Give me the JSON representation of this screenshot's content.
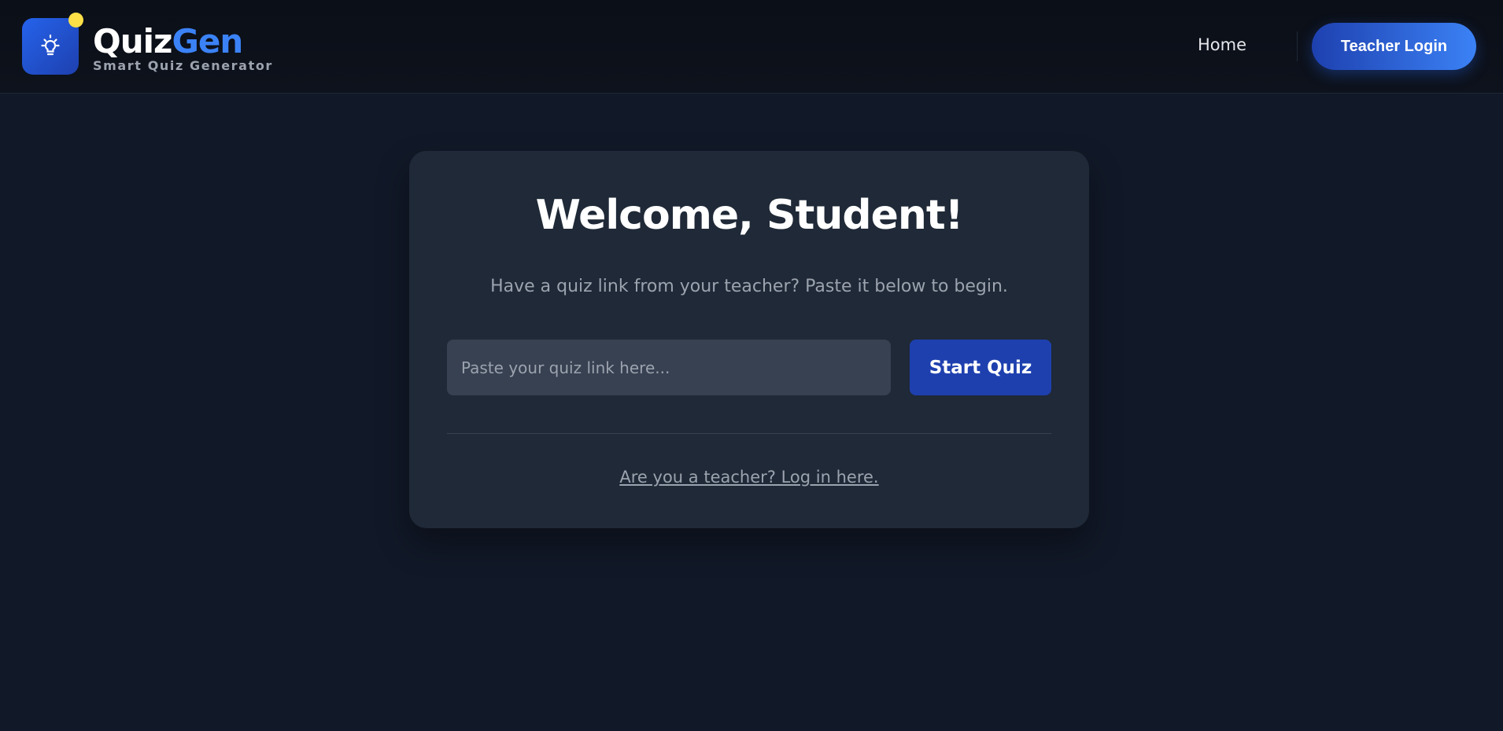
{
  "header": {
    "brand_part1": "Quiz",
    "brand_part2": "Gen",
    "tagline": "Smart Quiz Generator",
    "logo_icon": "lightbulb-icon",
    "nav_home": "Home",
    "teacher_login": "Teacher Login"
  },
  "main": {
    "title": "Welcome, Student!",
    "subtitle": "Have a quiz link from your teacher? Paste it below to begin.",
    "input_placeholder": "Paste your quiz link here...",
    "input_value": "",
    "start_button": "Start Quiz",
    "teacher_link": "Are you a teacher? Log in here."
  },
  "colors": {
    "background": "#111827",
    "card": "#1f2937",
    "accent": "#3b82f6",
    "button": "#1e40af",
    "notification_dot": "#fde047"
  }
}
